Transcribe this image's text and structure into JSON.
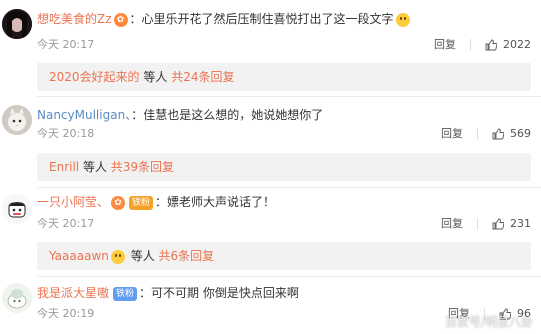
{
  "comments": [
    {
      "username": "想吃美食的Zz",
      "separator": "：",
      "text": "心里乐开花了然后压制住喜悦打出了这一段文字",
      "time": "今天 20:17",
      "reply_label": "回复",
      "likes": "2022",
      "replies": {
        "first_user": "2020会好起来的",
        "mid": " 等人 ",
        "count_text": "共24条回复"
      }
    },
    {
      "username": "NancyMulligan、",
      "separator": "：",
      "text": "佳慧也是这么想的，她说她想你了",
      "time": "今天 20:18",
      "reply_label": "回复",
      "likes": "569",
      "replies": {
        "first_user": "Enrill",
        "mid": " 等人 ",
        "count_text": "共39条回复"
      }
    },
    {
      "username": "一只小阿莹、",
      "badge": "铁粉",
      "separator": "：",
      "text": "嫖老师大声说话了！",
      "time": "今天 20:17",
      "reply_label": "回复",
      "likes": "231",
      "replies": {
        "first_user": "Yaaaaawn",
        "mid": " 等人 ",
        "count_text": "共6条回复"
      }
    },
    {
      "username": "我是派大星嗷",
      "badge": "铁粉",
      "separator": "：",
      "text": "可不可期 你倒是快点回来啊",
      "time": "今天 20:19",
      "reply_label": "回复",
      "likes": "96"
    }
  ],
  "watermark": "百家号/明星八卦",
  "colors": {
    "username": "#eb7350",
    "fans_badge": "#5f9df0",
    "reply_bg": "#f2f2f2",
    "meta": "#999999"
  }
}
